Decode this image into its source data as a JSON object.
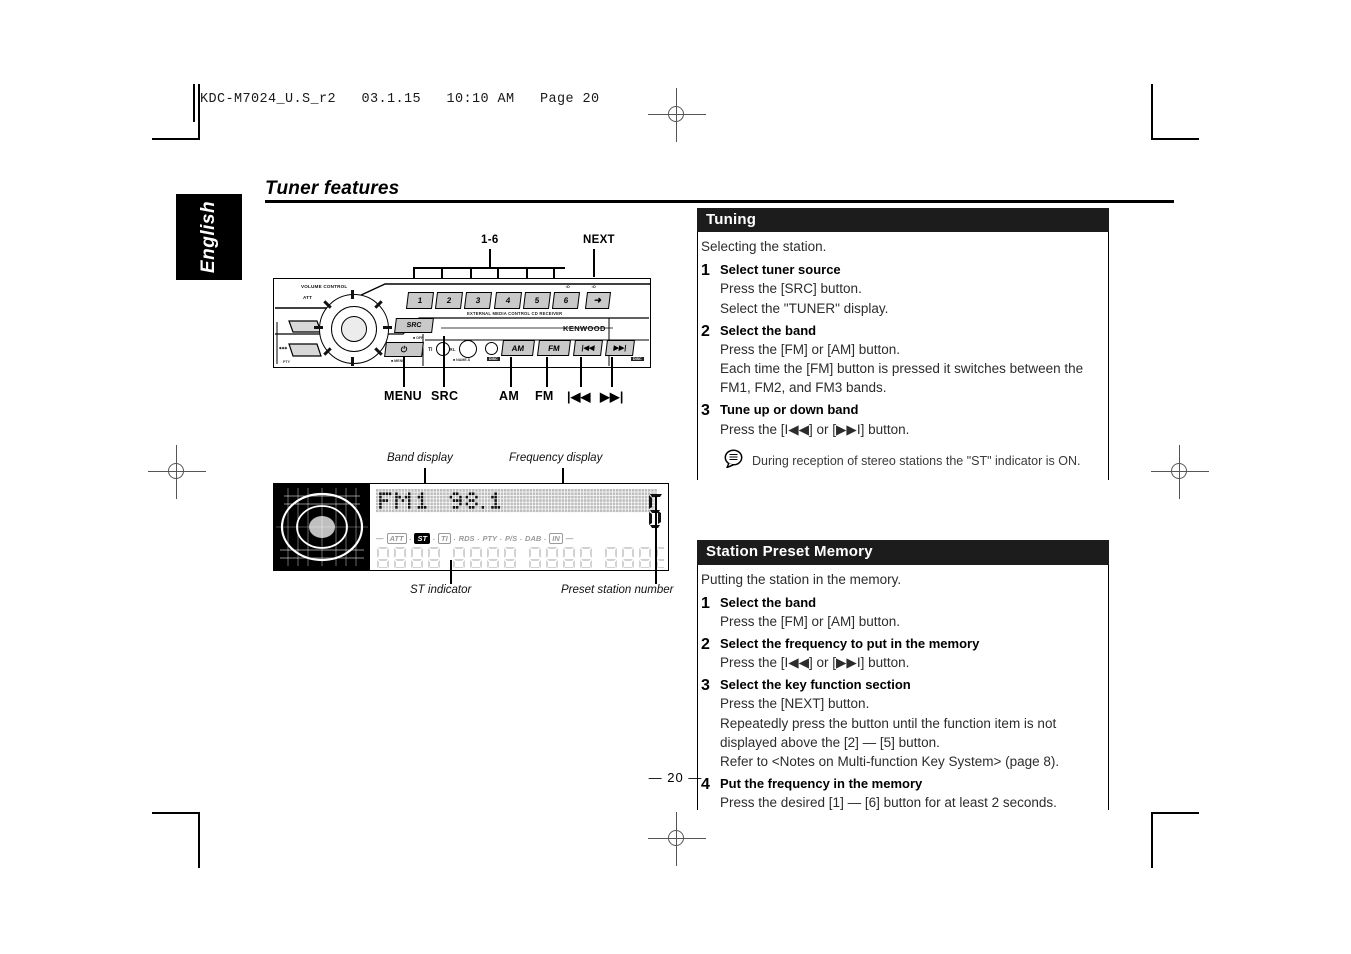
{
  "print_header": {
    "text": "KDC-M7024_U.S_r2   03.1.15   10:10 AM   Page 20"
  },
  "language_tab": {
    "label": "English"
  },
  "page_title": {
    "text": "Tuner features"
  },
  "page_number": {
    "text": "— 20 —"
  },
  "figure_faceplate": {
    "callouts_top": [
      {
        "label": "1-6"
      },
      {
        "label": "NEXT"
      }
    ],
    "callouts_bottom": [
      {
        "label": "MENU"
      },
      {
        "label": "SRC"
      },
      {
        "label": "AM"
      },
      {
        "label": "FM"
      },
      {
        "label": "|◀◀"
      },
      {
        "label": "▶▶|"
      }
    ],
    "panel_text": {
      "volume_control": "VOLUME CONTROL",
      "att": "ATT",
      "src": "SRC",
      "src_off": "OFF",
      "menu_sub": "MENU",
      "model_line": "EXTERNAL MEDIA CONTROL CD RECEIVER",
      "brand": "KENWOOD",
      "ti": "TI",
      "scrl": "SCRL",
      "name": "NAME.S",
      "ptylabel": "PTY",
      "disc": "DISC",
      "next_arrow": "➜"
    },
    "preset_buttons": [
      "1",
      "2",
      "3",
      "4",
      "5",
      "6"
    ],
    "band_buttons": [
      "AM",
      "FM"
    ],
    "track_buttons": [
      "|◀◀",
      "▶▶|"
    ]
  },
  "figure_display": {
    "callouts": {
      "band_display": "Band display",
      "frequency_display": "Frequency display",
      "st_indicator": "ST indicator",
      "preset_station_number": "Preset station number"
    },
    "indicators": [
      {
        "label": "ATT",
        "boxed": true,
        "active": false
      },
      {
        "label": "ST",
        "boxed": true,
        "active": true
      },
      {
        "label": "TI",
        "boxed": true,
        "active": false
      },
      {
        "label": "RDS",
        "boxed": false,
        "active": false
      },
      {
        "label": "PTY",
        "boxed": false,
        "active": false
      },
      {
        "label": "P/S",
        "boxed": false,
        "active": false
      },
      {
        "label": "DAB",
        "boxed": false,
        "active": false
      },
      {
        "label": "IN",
        "boxed": true,
        "active": false
      }
    ],
    "band_value": "FM1",
    "frequency_value": "98.1",
    "preset_value": "6"
  },
  "sections": [
    {
      "heading": "Tuning",
      "lead": "Selecting the station.",
      "steps": [
        {
          "num": "1",
          "head": "Select tuner source",
          "lines": [
            "Press the [SRC] button.",
            "Select the \"TUNER\" display."
          ]
        },
        {
          "num": "2",
          "head": "Select the band",
          "lines": [
            "Press the [FM] or [AM] button.",
            "Each time the [FM] button is pressed it switches between the",
            "FM1, FM2, and FM3 bands."
          ]
        },
        {
          "num": "3",
          "head": "Tune up or down band",
          "lines": [
            "Press the [I◀◀] or [▶▶I] button."
          ]
        }
      ],
      "note": "During reception of stereo stations the \"ST\" indicator is ON."
    },
    {
      "heading": "Station Preset Memory",
      "lead": "Putting the station in the memory.",
      "steps": [
        {
          "num": "1",
          "head": "Select the band",
          "lines": [
            "Press the [FM] or [AM] button."
          ]
        },
        {
          "num": "2",
          "head": "Select the frequency to put in the memory",
          "lines": [
            "Press the [I◀◀] or [▶▶I] button."
          ]
        },
        {
          "num": "3",
          "head": "Select the key function section",
          "lines": [
            "Press the [NEXT] button.",
            "Repeatedly press the button until the function item is not",
            "displayed above the [2] — [5] button.",
            "Refer to <Notes on Multi-function Key System> (page 8)."
          ]
        },
        {
          "num": "4",
          "head": "Put the frequency in the memory",
          "lines": [
            "Press the desired [1] — [6] button for at least 2 seconds."
          ]
        }
      ],
      "note": null
    }
  ]
}
